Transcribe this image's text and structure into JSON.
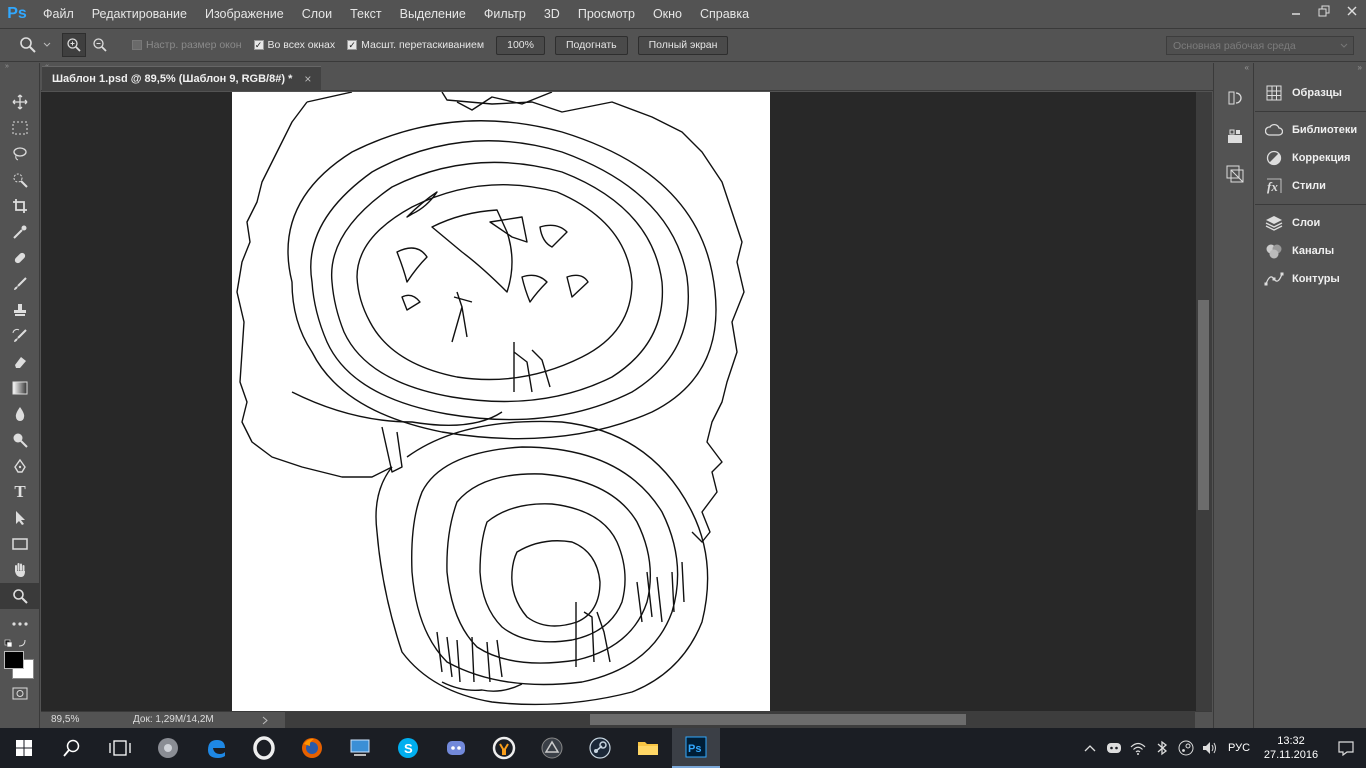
{
  "menubar": {
    "logo": "Ps",
    "items": [
      "Файл",
      "Редактирование",
      "Изображение",
      "Слои",
      "Текст",
      "Выделение",
      "Фильтр",
      "3D",
      "Просмотр",
      "Окно",
      "Справка"
    ]
  },
  "options": {
    "resize_windows": "Настр. размер окон",
    "all_windows": "Во всех окнах",
    "scrubby_zoom": "Масшт. перетаскиванием",
    "zoom_value": "100%",
    "fit_button": "Подогнать",
    "fullscreen_button": "Полный экран",
    "workspace": "Основная рабочая среда"
  },
  "document": {
    "tab_title": "Шаблон 1.psd @ 89,5% (Шаблон 9, RGB/8#) *",
    "close": "×"
  },
  "status": {
    "zoom": "89,5%",
    "doc_info": "Док: 1,29M/14,2M"
  },
  "panels": [
    {
      "label": "Образцы",
      "icon": "swatches-icon"
    },
    {
      "label": "Библиотеки",
      "icon": "libraries-icon"
    },
    {
      "label": "Коррекция",
      "icon": "adjustments-icon"
    },
    {
      "label": "Стили",
      "icon": "styles-icon"
    },
    {
      "label": "Слои",
      "icon": "layers-icon"
    },
    {
      "label": "Каналы",
      "icon": "channels-icon"
    },
    {
      "label": "Контуры",
      "icon": "paths-icon"
    }
  ],
  "tray": {
    "language": "РУС",
    "time": "13:32",
    "date": "27.11.2016"
  },
  "colors": {
    "ui_bg": "#535353",
    "canvas_bg": "#282828",
    "ps_blue": "#31a8ff",
    "taskbar": "#1b1e24"
  }
}
